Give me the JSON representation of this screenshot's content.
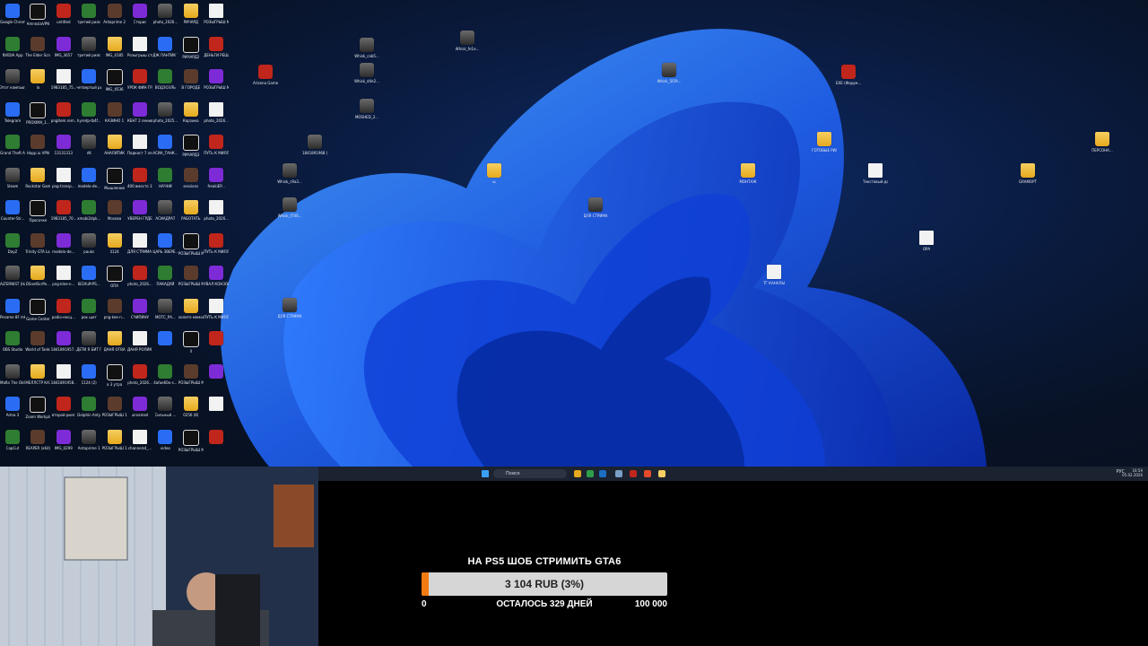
{
  "desktop": {
    "left_icons": [
      [
        "Google Chrome",
        "AmneziaVPN",
        "untitled",
        "третий рилс",
        "Antaprime 2",
        "Сторис",
        "photo_2026...",
        "РИЧАРД",
        "РОЗЫГРЫШ МЕЛЛСТР..."
      ],
      [
        "NVIDIA App",
        "The Elder Scrolls Online",
        "IMG_3657",
        "третий рилс",
        "IMG_4185",
        "Розыгрыш сторис",
        "ДЖ ПАНТИК ТОК 2",
        "РИЧАРД2",
        "ДЕНЬГИ РЕШАЮТ"
      ],
      [
        "Этот компьют...",
        "lo",
        "1983185_75...",
        "четвертый рилс",
        "IMG_4536",
        "УРОК ФИН ГРАМОТ",
        "ВОДЗОЗЛЬ",
        "В ГОРОДЕ",
        "РОЗЫГРЫШ МЕЛЛСТР..."
      ],
      [
        "Telegram",
        "PROXIMA_1...",
        "pngitem.rem...",
        "hyredp-lb4f...",
        "КАЗИНО 1",
        "КЕНТ 2 ленив",
        "photo_2025...",
        "Корзина",
        "photo_2026..."
      ],
      [
        "Grand Theft Auto III - T...",
        "Happ.iu VPN",
        "13131313",
        "VK",
        "АНАЛИТИК",
        "Подкаст 7 ленив",
        "АСИА_ТАНК...",
        "РИЧАРД3",
        "ПУТЬ К МИЛЛИО..."
      ],
      [
        "Steam",
        "Rockstar Games ...",
        "png-transp...",
        "modelo-de...",
        "Мышление",
        "400 вместо 15",
        "НАЧНИ",
        "sessions",
        "freakiEP..."
      ],
      [
        "Counter-Str...",
        "Просочке",
        "1983185_70...",
        "xmobi2dpk...",
        "Москва",
        "УВЕРЕН ГРДЕ",
        "АСИАДРАТ",
        "РАБОТАТЬ",
        "photo_2026..."
      ],
      [
        "DayZ",
        "Trinity GTA Launcher",
        "modelo-de...",
        "pauks",
        "0124",
        "ДЛЯ СТРИМА 24",
        "ЦАРЬ ЗВЕРЕ...",
        "РОЗЫГРЫШ МЕЛЛСТР...",
        "ПУТЬ К МИЛЛИО..."
      ],
      [
        "ALTERNIST (Hacwpoil)",
        "DSnetScrPe...",
        "png-klee-n...",
        "6EOfuPrPS...",
        "ОПА",
        "photo_2026...",
        "ПАКАДУЙ",
        "РОЗЫГРЫШ МЕЛЛСТР...",
        "УВАЛ КОНЗОР..."
      ],
      [
        "Pesame 8F mk10",
        "Game Center",
        "podio-ексц...",
        "рок щет",
        "png-kee-n...",
        "СЧИПИНУ",
        "МОТС_РА...",
        "холите мемостройк",
        "ПУТЬ К МИЛЛИО..."
      ],
      [
        "OBS Studio",
        "World of Tanks RU",
        "1841891957...",
        "ДЕТИ Я БИТ ПРОД",
        "ДАНЯ ОГВА",
        "ДАНЯ РОЛИК 1",
        "",
        "4",
        ""
      ],
      [
        "Mafia The Old Country",
        "МЕЛЛСТР КАЗИНО",
        "1841891958...",
        "1124 (2)",
        "а 3 утра",
        "photo_2026...",
        "4afae60o-s...",
        "РОЗЫГРЫШ МЕЛЛСТР...",
        ""
      ],
      [
        "Arma 3",
        "Zoom Workplace",
        "второй рилс",
        "Dolphin Anty",
        "РОЗЫГРЫШ 1",
        "unnamed",
        "Сильный ...",
        "0256 (8)",
        ""
      ],
      [
        "CapCut",
        "REAPER (x64)",
        "IMG_0299",
        "Antaprime 1",
        "РОЗЫГРЫШ 1Р",
        "channels4_...",
        "video",
        "РОЗЫГРЫШ МЕЛЛСТР...",
        ""
      ]
    ],
    "scattered_icons": [
      {
        "label": "Whisk_cab5...",
        "kind": "photo"
      },
      {
        "label": "Whisk_fe1e...",
        "kind": "photo"
      },
      {
        "label": "Arizona Games ...",
        "kind": "app"
      },
      {
        "label": "Whisk_d4e2...",
        "kind": "photo"
      },
      {
        "label": "Whisk_5f29...",
        "kind": "photo"
      },
      {
        "label": "EXE (Форум...",
        "kind": "app"
      },
      {
        "label": "MOSHED_2...",
        "kind": "photo"
      },
      {
        "label": "1841891968 (1)",
        "kind": "photo"
      },
      {
        "label": "ГОТОВЫЕ РИЛС",
        "kind": "folder"
      },
      {
        "label": "ПЕРСОНА...",
        "kind": "folder"
      },
      {
        "label": "Whisk_c9a3...",
        "kind": "photo"
      },
      {
        "label": "ы",
        "kind": "folder"
      },
      {
        "label": "МОНТАЖ",
        "kind": "folder"
      },
      {
        "label": "Текстовый документ",
        "kind": "doc"
      },
      {
        "label": "GRAMOPT",
        "kind": "folder"
      },
      {
        "label": "Whisk_f740...",
        "kind": "photo"
      },
      {
        "label": "ДЛЯ СТРИМА",
        "kind": "photo"
      },
      {
        "label": "ОРА",
        "kind": "doc"
      },
      {
        "label": "ТГ КАНАЛЫ",
        "kind": "doc"
      },
      {
        "label": "ДЛЯ СТРИМА",
        "kind": "photo"
      }
    ]
  },
  "taskbar": {
    "search_placeholder": "Поиск",
    "tray_lang": "РУС",
    "time": "16:59",
    "date": "05.02.2026"
  },
  "donation": {
    "title": "НА PS5 ШОБ СТРИМИТЬ GTA6",
    "amount_label": "3 104 RUB (3%)",
    "progress_fraction": 0.03,
    "min_label": "0",
    "remaining_label": "ОСТАЛОСЬ 329 ДНЕЙ",
    "max_label": "100 000",
    "accent_color": "#f47a12"
  }
}
